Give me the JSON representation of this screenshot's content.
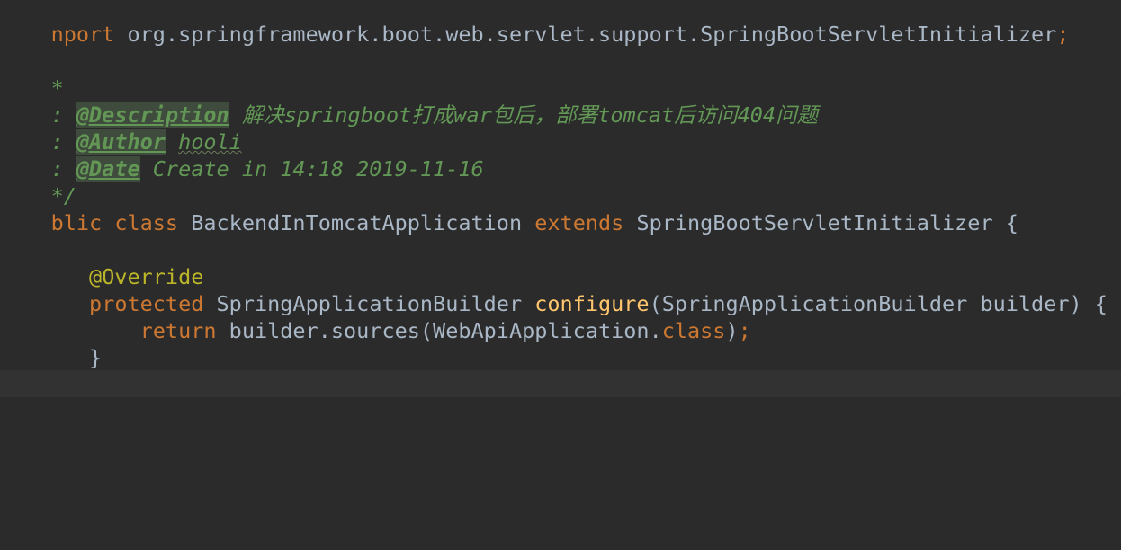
{
  "editor": {
    "language": "Java",
    "colors": {
      "background": "#2b2b2b",
      "caret_line": "#323232",
      "keyword": "#cc7832",
      "doc_comment": "#629755",
      "annotation": "#bbb529",
      "method_declaration": "#ffc66d",
      "default_text": "#a9b7c6"
    },
    "lines": {
      "import_keyword": "nport",
      "import_path": " org.springframework.boot.web.servlet.support.SpringBootServletInitializer",
      "import_semicolon": ";",
      "doc_open": "*",
      "desc_gutter": ": ",
      "desc_tag": "@Description",
      "desc_text": " 解决springboot打成war包后，部署tomcat后访问404问题",
      "author_gutter": ": ",
      "author_tag": "@Author",
      "author_space": " ",
      "author_name": "hooli",
      "date_gutter": ": ",
      "date_tag": "@Date",
      "date_text": " Create in 14:18 2019-11-16",
      "doc_close": "*/",
      "class_mod": "blic",
      "class_sp1": " ",
      "class_kw": "class",
      "class_name": " BackendInTomcatApplication ",
      "extends_kw": "extends",
      "class_rest": " SpringBootServletInitializer {",
      "override_indent": "   ",
      "override_annot": "@Override",
      "method_indent": "   ",
      "method_mod": "protected",
      "method_type": " SpringApplicationBuilder ",
      "method_name": "configure",
      "method_params": "(SpringApplicationBuilder builder) {",
      "return_indent": "       ",
      "return_kw": "return",
      "return_expr": " builder.sources(WebApiApplication.",
      "return_class_kw": "class",
      "return_close": ")",
      "return_semi": ";",
      "closing_brace": "   }"
    }
  }
}
